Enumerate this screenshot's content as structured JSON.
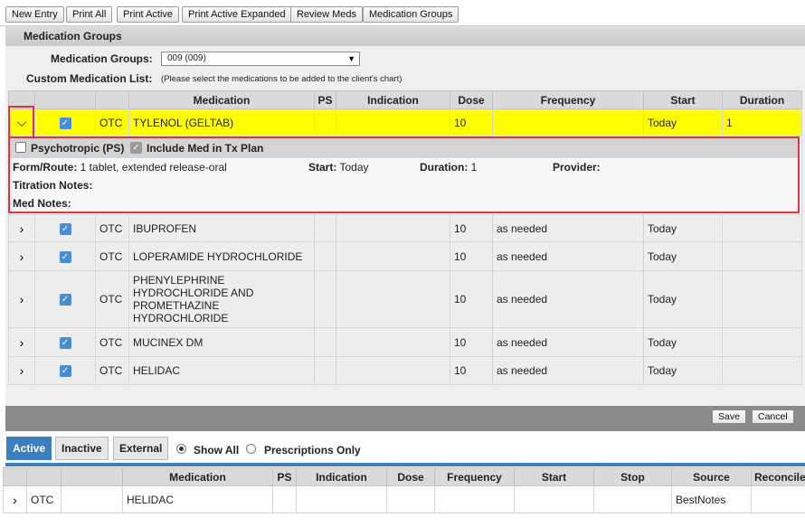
{
  "toolbar": {
    "buttons": [
      "New Entry",
      "Print All",
      "Print Active",
      "Print Active Expanded",
      "Review Meds",
      "Medication Groups"
    ]
  },
  "panel": {
    "title": "Medication Groups",
    "group_label": "Medication Groups:",
    "group_value": "009 (009)",
    "custom_label": "Custom Medication List:",
    "custom_hint": "(Please select the medications to be added to the client's chart)"
  },
  "grid": {
    "headers": [
      "Medication",
      "PS",
      "Indication",
      "Dose",
      "Frequency",
      "Start",
      "Duration"
    ],
    "selected": {
      "type": "OTC",
      "medication": "TYLENOL (GELTAB)",
      "dose": "10",
      "frequency": "",
      "start": "Today",
      "duration": "1"
    },
    "rows": [
      {
        "type": "OTC",
        "medication": "IBUPROFEN",
        "dose": "10",
        "frequency": "as needed",
        "start": "Today"
      },
      {
        "type": "OTC",
        "medication": "LOPERAMIDE HYDROCHLORIDE",
        "dose": "10",
        "frequency": "as needed",
        "start": "Today"
      },
      {
        "type": "OTC",
        "medication": "PHENYLEPHRINE HYDROCHLORIDE AND PROMETHAZINE HYDROCHLORIDE",
        "dose": "10",
        "frequency": "as needed",
        "start": "Today"
      },
      {
        "type": "OTC",
        "medication": "MUCINEX DM",
        "dose": "10",
        "frequency": "as needed",
        "start": "Today"
      },
      {
        "type": "OTC",
        "medication": "HELIDAC",
        "dose": "10",
        "frequency": "as needed",
        "start": "Today"
      }
    ]
  },
  "expanded": {
    "psychotropic_label": "Psychotropic (PS)",
    "include_label": "Include Med in Tx Plan",
    "form_route_label": "Form/Route:",
    "form_route_value": "1 tablet, extended release-oral",
    "start_label": "Start:",
    "start_value": "Today",
    "duration_label": "Duration:",
    "duration_value": "1",
    "provider_label": "Provider:",
    "titration_label": "Titration Notes:",
    "med_notes_label": "Med Notes:"
  },
  "actions": {
    "save": "Save",
    "cancel": "Cancel"
  },
  "tabs": {
    "items": [
      "Active",
      "Inactive",
      "External"
    ],
    "radio_show_all": "Show All",
    "radio_rx_only": "Prescriptions Only"
  },
  "bottom_grid": {
    "headers": [
      "Medication",
      "PS",
      "Indication",
      "Dose",
      "Frequency",
      "Start",
      "Stop",
      "Source",
      "Reconciled"
    ],
    "row": {
      "type": "OTC",
      "medication": "HELIDAC",
      "source": "BestNotes"
    }
  },
  "colors": {
    "highlight": "#ffff00",
    "accent": "#3c7fbf",
    "outline": "#e0353f",
    "checkbox": "#4a8cd6"
  }
}
